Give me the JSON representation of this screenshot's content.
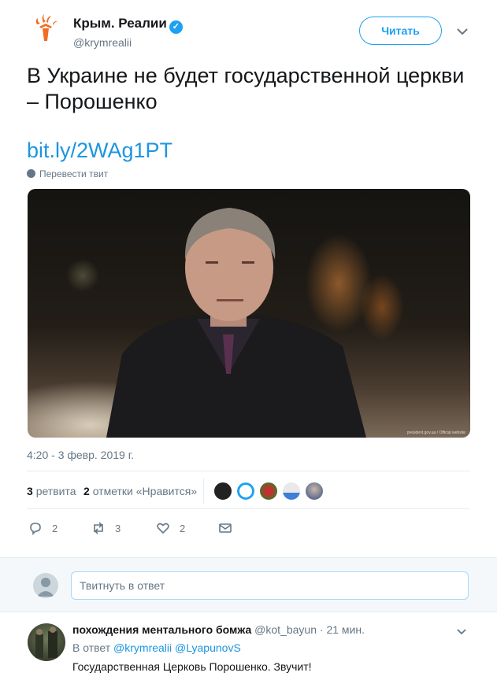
{
  "account": {
    "name": "Крым. Реалии",
    "handle": "@krymrealii",
    "follow_label": "Читать",
    "brand_color": "#f26b21"
  },
  "tweet": {
    "text": "В Украине не будет государственной церкви – Порошенко",
    "link": "bit.ly/2WAg1PT",
    "translate_label": "Перевести твит",
    "media_credit": "president.gov.ua / Official website",
    "timestamp": "4:20 - 3 февр. 2019 г."
  },
  "stats": {
    "retweets_count": "3",
    "retweets_label": "ретвита",
    "likes_count": "2",
    "likes_label": "отметки «Нравится»"
  },
  "actions": {
    "reply_count": "2",
    "retweet_count": "3",
    "like_count": "2"
  },
  "reply_box": {
    "placeholder": "Твитнуть в ответ"
  },
  "reply_tweet": {
    "name": "похождения ментального бомжа",
    "handle": "@kot_bayun",
    "time": "· 21 мин.",
    "reply_prefix": "В ответ",
    "reply_to_1": "@krymrealii",
    "reply_to_2": "@LyapunovS",
    "text": "Государственная Церковь Порошенко. Звучит!"
  },
  "colors": {
    "accent": "#1da1f2",
    "link": "#1b95e0",
    "muted": "#657786"
  }
}
